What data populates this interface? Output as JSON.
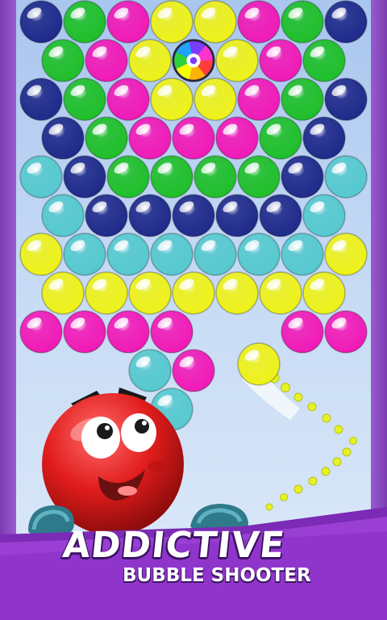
{
  "banner": {
    "title": "ADDICTIVE",
    "subtitle": "BUBBLE SHOOTER"
  },
  "colors": {
    "navy": "#1f2a8a",
    "green": "#1fbf2a",
    "magenta": "#f11ab7",
    "yellow": "#eef21a",
    "teal": "#56c9cf",
    "red": "#e32020",
    "frame": "#7a3bb0",
    "banner": "#8e2fc4"
  },
  "bubble_grid": [
    [
      "navy",
      "green",
      "magenta",
      "yellow",
      "yellow",
      "magenta",
      "green",
      "navy"
    ],
    [
      "green",
      "magenta",
      "yellow",
      "rainbow",
      "yellow",
      "magenta",
      "green"
    ],
    [
      "navy",
      "green",
      "magenta",
      "yellow",
      "yellow",
      "magenta",
      "green",
      "navy"
    ],
    [
      "navy",
      "green",
      "magenta",
      "magenta",
      "magenta",
      "green",
      "navy"
    ],
    [
      "teal",
      "navy",
      "green",
      "green",
      "green",
      "green",
      "navy",
      "teal"
    ],
    [
      "teal",
      "navy",
      "navy",
      "navy",
      "navy",
      "navy",
      "teal"
    ],
    [
      "yellow",
      "teal",
      "teal",
      "teal",
      "teal",
      "teal",
      "teal",
      "yellow"
    ],
    [
      "yellow",
      "yellow",
      "yellow",
      "yellow",
      "yellow",
      "yellow",
      "yellow"
    ],
    [
      "magenta",
      "magenta",
      "magenta",
      "magenta",
      "",
      "",
      "magenta",
      "magenta"
    ],
    [
      "",
      "",
      "teal",
      "magenta",
      "",
      "",
      "",
      ""
    ],
    [
      "",
      "",
      "",
      "teal",
      "",
      "",
      "",
      ""
    ]
  ],
  "shooter_bubble": "yellow",
  "mascot": {
    "color": "red",
    "icon": "red-bubble-mascot-icon"
  },
  "special_bubble": {
    "icon": "rainbow-bubble-icon"
  }
}
